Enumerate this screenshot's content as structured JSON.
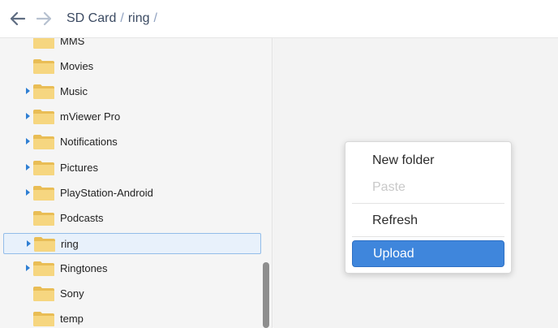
{
  "breadcrumb": {
    "items": [
      "SD Card",
      "ring"
    ],
    "separator": "/"
  },
  "tree": {
    "items": [
      {
        "label": "MMS",
        "expandable": false,
        "selected": false
      },
      {
        "label": "Movies",
        "expandable": false,
        "selected": false
      },
      {
        "label": "Music",
        "expandable": true,
        "selected": false
      },
      {
        "label": "mViewer Pro",
        "expandable": true,
        "selected": false
      },
      {
        "label": "Notifications",
        "expandable": true,
        "selected": false
      },
      {
        "label": "Pictures",
        "expandable": true,
        "selected": false
      },
      {
        "label": "PlayStation-Android",
        "expandable": true,
        "selected": false
      },
      {
        "label": "Podcasts",
        "expandable": false,
        "selected": false
      },
      {
        "label": "ring",
        "expandable": true,
        "selected": true
      },
      {
        "label": "Ringtones",
        "expandable": true,
        "selected": false
      },
      {
        "label": "Sony",
        "expandable": false,
        "selected": false
      },
      {
        "label": "temp",
        "expandable": false,
        "selected": false
      }
    ]
  },
  "context_menu": {
    "new_folder": "New folder",
    "paste": "Paste",
    "refresh": "Refresh",
    "upload": "Upload"
  },
  "colors": {
    "accent": "#3f86dc",
    "folder": "#f4d27a",
    "expander": "#2f7fd3"
  },
  "icons": {
    "back": "arrow-left-icon",
    "forward": "arrow-right-icon",
    "folder": "folder-icon",
    "expander": "caret-right-icon"
  }
}
